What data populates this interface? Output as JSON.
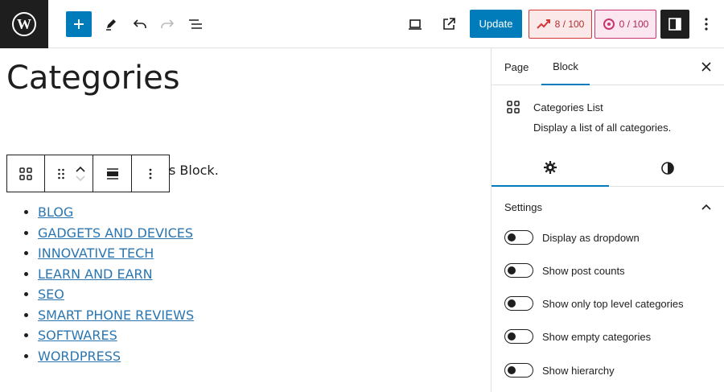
{
  "toolbar": {
    "update_label": "Update",
    "score_seo": "8 / 100",
    "score_readability": "0 / 100"
  },
  "editor": {
    "page_title": "Categories",
    "paragraph_fragment": "s Block.",
    "categories": [
      "BLOG",
      "GADGETS AND DEVICES",
      "INNOVATIVE TECH",
      "LEARN AND EARN",
      "SEO",
      "SMART PHONE REVIEWS",
      "SOFTWARES",
      "WORDPRESS"
    ]
  },
  "sidebar": {
    "tabs": [
      "Page",
      "Block"
    ],
    "block_title": "Categories List",
    "block_description": "Display a list of all categories.",
    "settings_title": "Settings",
    "toggles": [
      "Display as dropdown",
      "Show post counts",
      "Show only top level categories",
      "Show empty categories",
      "Show hierarchy"
    ]
  },
  "colors": {
    "accent": "#007cba",
    "link": "#2b76b1",
    "dark": "#1e1e1e"
  }
}
